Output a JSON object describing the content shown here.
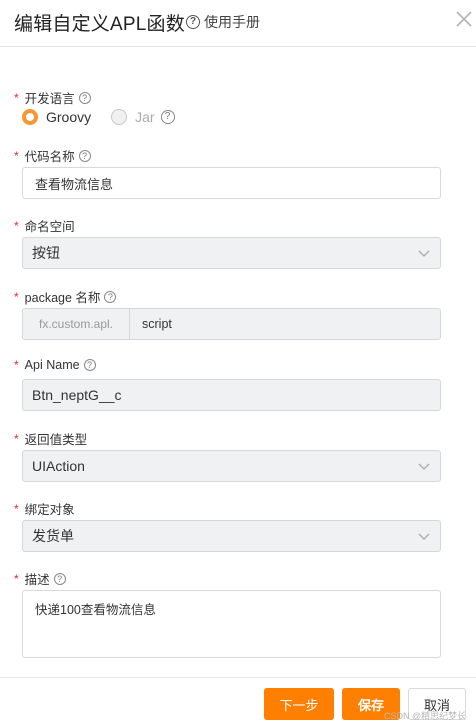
{
  "header": {
    "title": "编辑自定义APL函数",
    "help_label": "使用手册",
    "help_icon": "question-circle-icon",
    "close_icon": "close-icon"
  },
  "required_mark": "*",
  "fields": {
    "language": {
      "label": "开发语言",
      "options": [
        {
          "label": "Groovy",
          "selected": true
        },
        {
          "label": "Jar",
          "selected": false
        }
      ]
    },
    "code_name": {
      "label": "代码名称",
      "value": "查看物流信息"
    },
    "namespace": {
      "label": "命名空间",
      "value": "按钮"
    },
    "package": {
      "label": "package 名称",
      "prefix": "fx.custom.apl.",
      "value": "script"
    },
    "api_name": {
      "label": "Api Name",
      "value": "Btn_neptG__c"
    },
    "return_type": {
      "label": "返回值类型",
      "value": "UIAction"
    },
    "bind_object": {
      "label": "绑定对象",
      "value": "发货单"
    },
    "description": {
      "label": "描述",
      "value": "快递100查看物流信息"
    }
  },
  "footer": {
    "next_label": "下一步",
    "save_label": "保存",
    "cancel_label": "取消"
  },
  "watermark": "CSDN @精思纪梦长",
  "colors": {
    "accent": "#ff8000",
    "required": "#f5222d",
    "disabled_bg": "#f0f1f3"
  }
}
